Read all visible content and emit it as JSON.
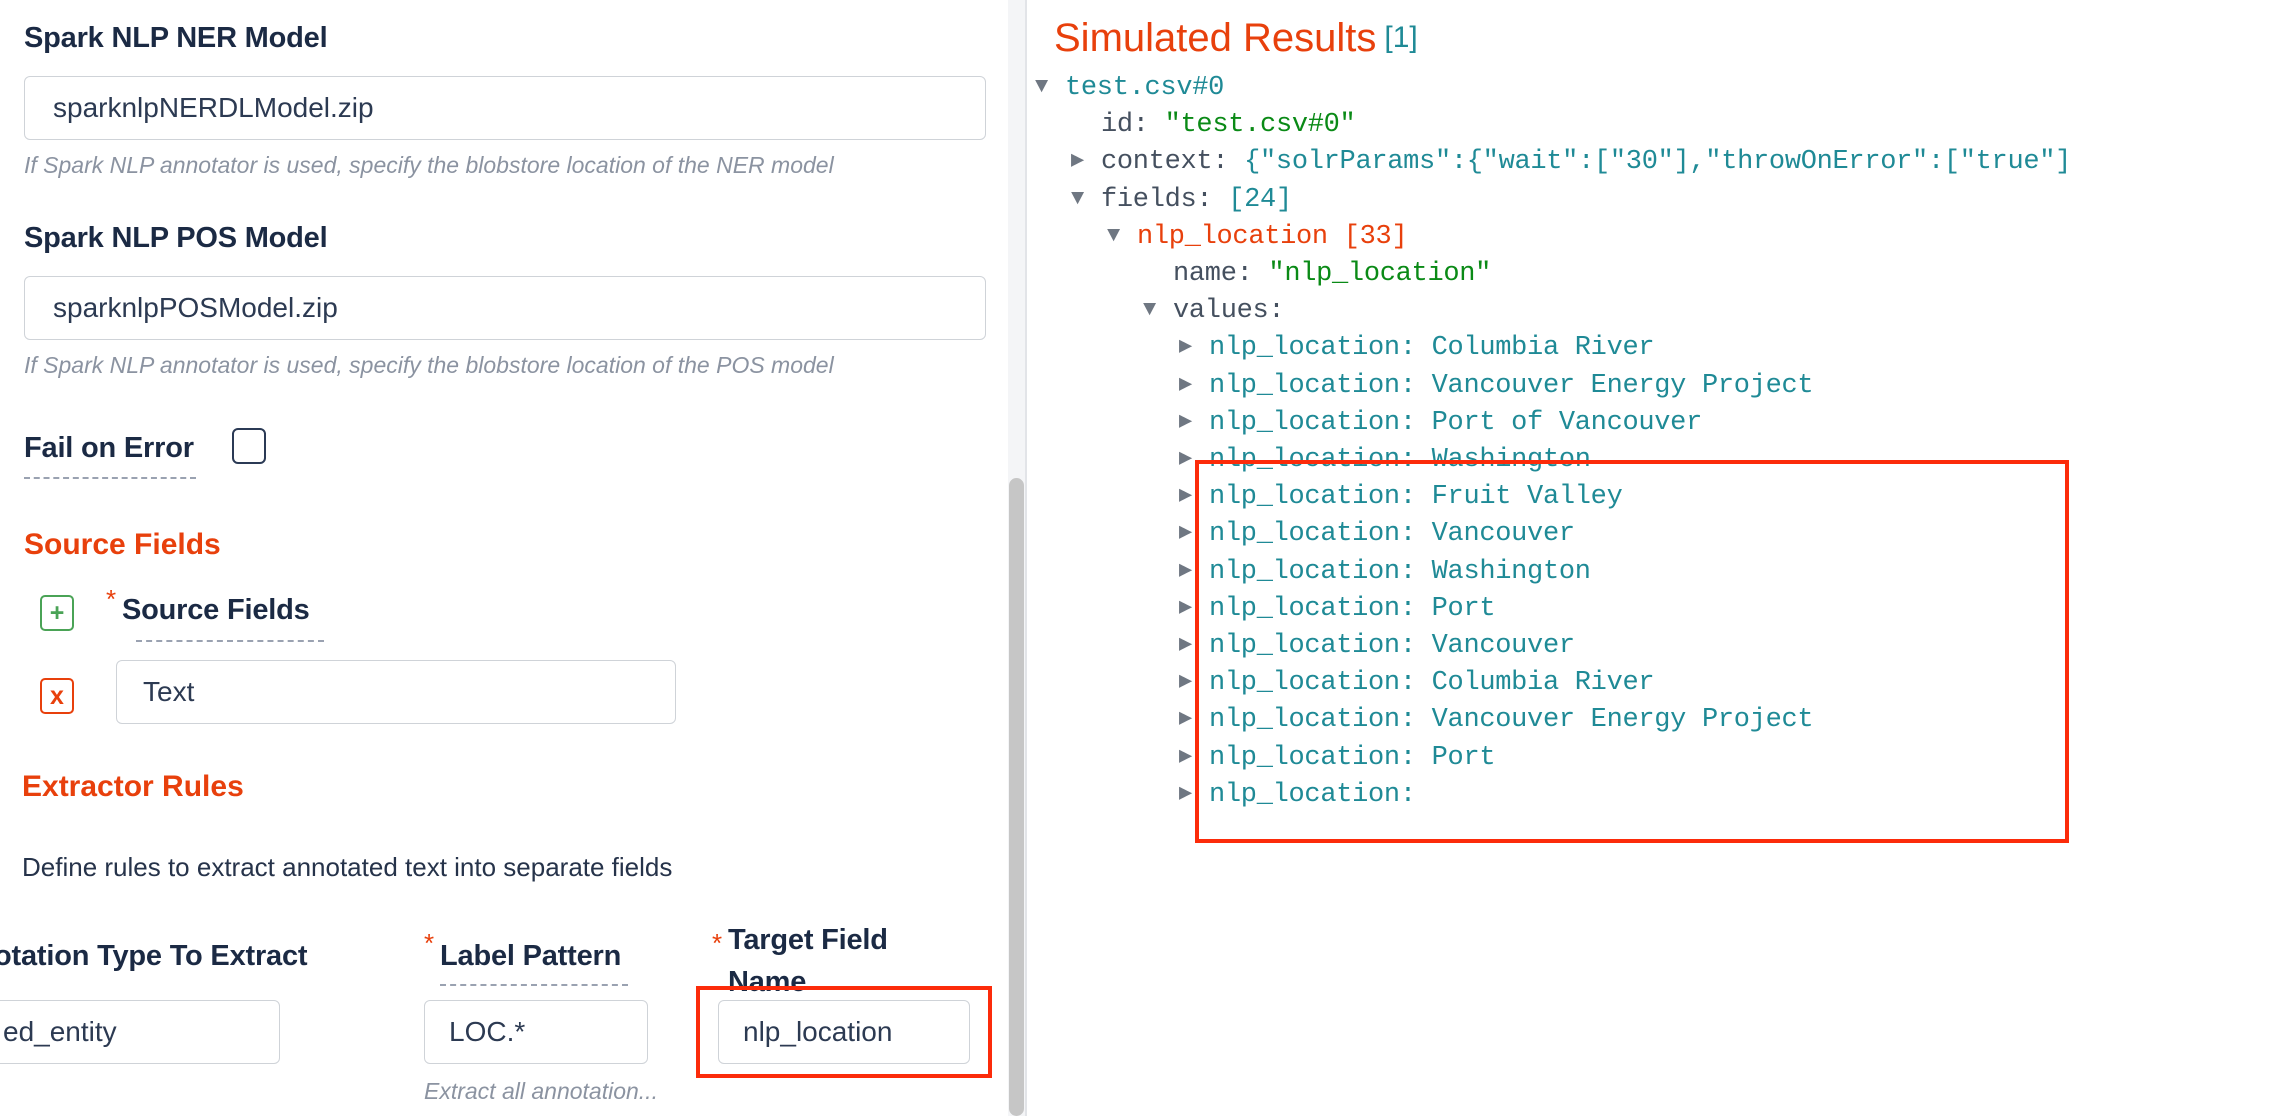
{
  "left_panel": {
    "ner_model": {
      "label": "Spark NLP NER Model",
      "value": "sparknlpNERDLModel.zip",
      "help": "If Spark NLP annotator is used, specify the blobstore location of the NER model"
    },
    "pos_model": {
      "label": "Spark NLP POS Model",
      "value": "sparknlpPOSModel.zip",
      "help": "If Spark NLP annotator is used, specify the blobstore location of the POS model"
    },
    "fail_on_error": {
      "label": "Fail on Error",
      "checked": false
    },
    "source_fields_section": {
      "title": "Source Fields",
      "field_label": "Source Fields",
      "required_marker": "*",
      "add_icon": "+",
      "remove_icon": "x",
      "entry_value": "Text"
    },
    "extractor_rules_section": {
      "title": "Extractor Rules",
      "description": "Define rules to extract annotated text into separate fields",
      "columns": {
        "annotation_type": {
          "label": "otation Type To Extract",
          "value": "ed_entity",
          "caret_icon": "chevron-down-icon"
        },
        "label_pattern": {
          "label": "Label Pattern",
          "required_marker": "*",
          "value": "LOC.*",
          "help": "Extract all annotation..."
        },
        "target_field_name": {
          "label_line1": "Target Field",
          "label_line2": "Name",
          "required_marker": "*",
          "value": "nlp_location",
          "highlighted": true
        }
      }
    },
    "scrollbar": {
      "name": "vertical-scrollbar"
    }
  },
  "right_panel": {
    "title": "Simulated Results",
    "count": "[1]",
    "tree": [
      {
        "indent": 0,
        "twisty": "open",
        "text_parts": [
          {
            "t": "test.csv#0",
            "c": "k-node"
          }
        ]
      },
      {
        "indent": 1,
        "twisty": "none",
        "text_parts": [
          {
            "t": "id: ",
            "c": "k-key"
          },
          {
            "t": "\"test.csv#0\"",
            "c": "k-str"
          }
        ]
      },
      {
        "indent": 1,
        "twisty": "closed",
        "text_parts": [
          {
            "t": "context: ",
            "c": "k-key"
          },
          {
            "t": "{\"solrParams\":{\"wait\":[\"30\"],\"throwOnError\":[\"true\"]",
            "c": "k-teal"
          }
        ]
      },
      {
        "indent": 1,
        "twisty": "open",
        "text_parts": [
          {
            "t": "fields: ",
            "c": "k-key"
          },
          {
            "t": "[24]",
            "c": "k-teal"
          }
        ]
      },
      {
        "indent": 2,
        "twisty": "open",
        "text_parts": [
          {
            "t": "nlp_location ",
            "c": "k-orange"
          },
          {
            "t": "[33]",
            "c": "k-orange"
          }
        ]
      },
      {
        "indent": 3,
        "twisty": "none",
        "text_parts": [
          {
            "t": "name: ",
            "c": "k-key"
          },
          {
            "t": "\"nlp_location\"",
            "c": "k-str"
          }
        ]
      },
      {
        "indent": 3,
        "twisty": "open",
        "text_parts": [
          {
            "t": "values:",
            "c": "k-key"
          }
        ]
      },
      {
        "indent": 4,
        "twisty": "closed",
        "text_parts": [
          {
            "t": "nlp_location: Columbia River",
            "c": "k-teal"
          }
        ]
      },
      {
        "indent": 4,
        "twisty": "closed",
        "text_parts": [
          {
            "t": "nlp_location: Vancouver Energy Project",
            "c": "k-teal"
          }
        ]
      },
      {
        "indent": 4,
        "twisty": "closed",
        "text_parts": [
          {
            "t": "nlp_location: Port of Vancouver",
            "c": "k-teal"
          }
        ]
      },
      {
        "indent": 4,
        "twisty": "closed",
        "text_parts": [
          {
            "t": "nlp_location: Washington",
            "c": "k-teal"
          }
        ]
      },
      {
        "indent": 4,
        "twisty": "closed",
        "text_parts": [
          {
            "t": "nlp_location: Fruit Valley",
            "c": "k-teal"
          }
        ]
      },
      {
        "indent": 4,
        "twisty": "closed",
        "text_parts": [
          {
            "t": "nlp_location: Vancouver",
            "c": "k-teal"
          }
        ]
      },
      {
        "indent": 4,
        "twisty": "closed",
        "text_parts": [
          {
            "t": "nlp_location: Washington",
            "c": "k-teal"
          }
        ]
      },
      {
        "indent": 4,
        "twisty": "closed",
        "text_parts": [
          {
            "t": "nlp_location: Port",
            "c": "k-teal"
          }
        ]
      },
      {
        "indent": 4,
        "twisty": "closed",
        "text_parts": [
          {
            "t": "nlp_location: Vancouver",
            "c": "k-teal"
          }
        ]
      },
      {
        "indent": 4,
        "twisty": "closed",
        "text_parts": [
          {
            "t": "nlp_location: Columbia River",
            "c": "k-teal"
          }
        ]
      },
      {
        "indent": 4,
        "twisty": "closed",
        "text_parts": [
          {
            "t": "nlp_location: Vancouver Energy Project",
            "c": "k-teal"
          }
        ]
      },
      {
        "indent": 4,
        "twisty": "closed",
        "text_parts": [
          {
            "t": "nlp_location: Port",
            "c": "k-teal"
          }
        ]
      },
      {
        "indent": 4,
        "twisty": "closed",
        "text_parts": [
          {
            "t": "nlp_location:",
            "c": "k-teal"
          }
        ]
      }
    ],
    "highlight": {
      "name": "values-highlight-box",
      "color": "#fc2b0a"
    }
  },
  "colors": {
    "accent_orange": "#e8400c",
    "teal": "#1f8a96",
    "green_string": "#0a8a16",
    "key_grey": "#45505f",
    "label_navy": "#1b2a44",
    "highlight_red": "#fc2b0a"
  }
}
